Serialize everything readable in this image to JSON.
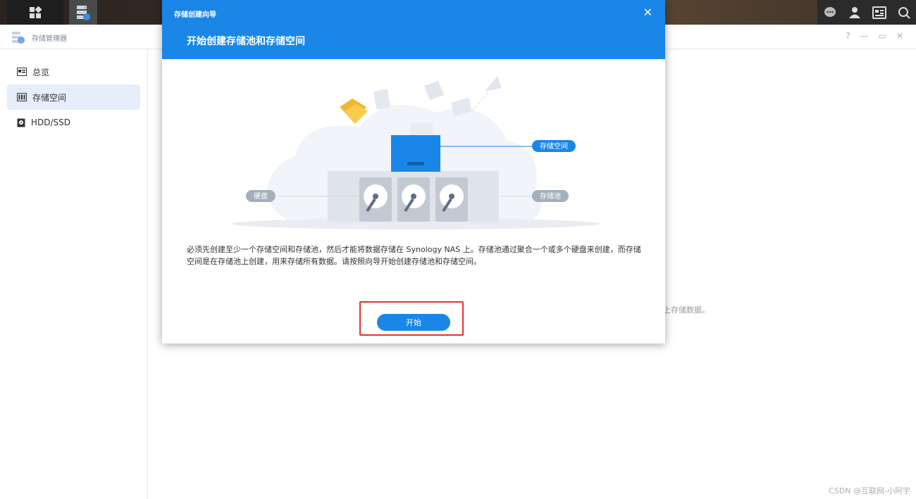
{
  "app": {
    "title": "存储管理器"
  },
  "window_controls": {
    "help": "?",
    "minimize": "—",
    "restore": "▭",
    "close": "✕"
  },
  "sidebar": {
    "items": [
      {
        "label": "总览",
        "icon": "overview-icon"
      },
      {
        "label": "存储空间",
        "icon": "storage-icon",
        "active": true
      },
      {
        "label": "HDD/SSD",
        "icon": "disk-icon"
      }
    ]
  },
  "background_hint": "上存储数据。",
  "dialog": {
    "small_title": "存储创建向导",
    "title": "开始创建存储池和存储空间",
    "close": "✕",
    "labels": {
      "volume": "存储空间",
      "disk": "硬盘",
      "pool": "存储池"
    },
    "description": "必须先创建至少一个存储空间和存储池，然后才能将数据存储在 Synology NAS 上。存储池通过聚合一个或多个硬盘来创建，而存储空间是在存储池上创建，用来存储所有数据。请按照向导开始创建存储池和存储空间。",
    "start_button": "开始"
  },
  "watermark": "CSDN @互联网-小阿宇",
  "colors": {
    "accent": "#1a86e8",
    "highlight": "#e53030",
    "active_nav": "#e5eefa"
  }
}
